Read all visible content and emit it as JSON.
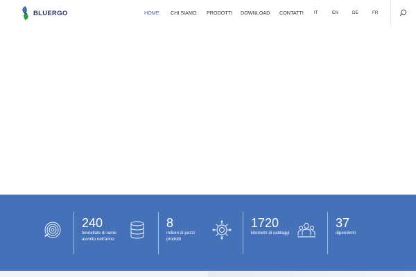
{
  "brand": {
    "name": "BLUERGO",
    "logo_colors": [
      "#3e6bb3",
      "#2f9a4a"
    ]
  },
  "nav": {
    "items": [
      {
        "label": "HOME",
        "active": true
      },
      {
        "label": "CHI SIAMO",
        "active": false
      },
      {
        "label": "PRODOTTI",
        "active": false
      },
      {
        "label": "DOWNLOAD",
        "active": false
      },
      {
        "label": "CONTATTI",
        "active": false
      }
    ],
    "languages": [
      "IT",
      "EN",
      "DE",
      "FR"
    ],
    "search_icon": "search-icon"
  },
  "stats": [
    {
      "icon": "copper-coil-icon",
      "value": "240",
      "label": "tonnellate di rame avvolto nell'anno"
    },
    {
      "icon": "stack-database-icon",
      "value": "8",
      "label": "milioni di pezzi prodotti"
    },
    {
      "icon": "gear-circuit-icon",
      "value": "1720",
      "label": "kilometri di cablaggi"
    },
    {
      "icon": "team-people-icon",
      "value": "37",
      "label": "dipendenti"
    }
  ],
  "colors": {
    "accent": "#3e6bb3",
    "band": "#4471b8",
    "text": "#333333"
  }
}
